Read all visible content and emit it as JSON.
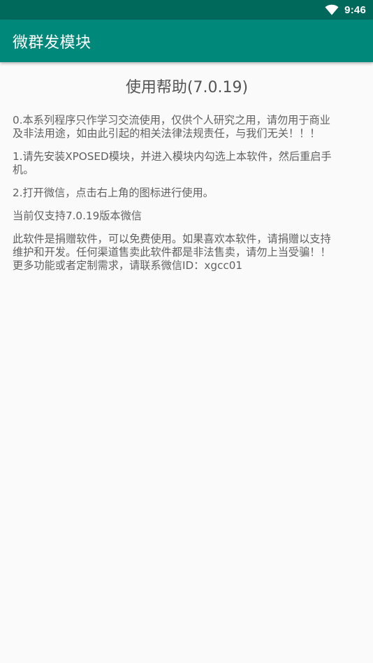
{
  "status_bar": {
    "time": "9:46",
    "icons": [
      "wifi-icon"
    ]
  },
  "app_bar": {
    "title": "微群发模块"
  },
  "help": {
    "title": "使用帮助(7.0.19)",
    "paragraphs": [
      [
        "0.本系列程序只作学习交流使用，仅供个人研究之用，请勿用于商业",
        "及非法用途，如由此引起的相关法律法规责任，与我们无关！！！"
      ],
      [
        "1.请先安装XPOSED模块，并进入模块内勾选上本软件，然后重启手",
        "机。"
      ],
      [
        "2.打开微信，点击右上角的图标进行使用。"
      ],
      [
        "当前仅支持7.0.19版本微信"
      ],
      [
        "此软件是捐赠软件，可以免费使用。如果喜欢本软件，请捐赠以支持",
        "维护和开发。任何渠道售卖此软件都是非法售卖，请勿上当受骗！！",
        "更多功能或者定制需求，请联系微信ID：xgcc01"
      ]
    ]
  },
  "colors": {
    "status_bar": "#00695c",
    "app_bar": "#00897b",
    "background": "#fafafa",
    "text": "#616161"
  }
}
